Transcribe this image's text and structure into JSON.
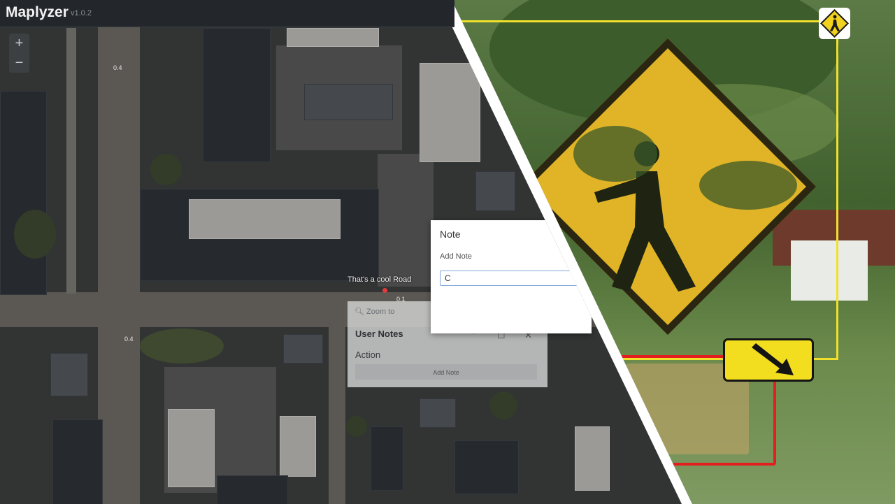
{
  "app": {
    "name": "Maplyzer",
    "version": "v1.0.2"
  },
  "zoom": {
    "in_label": "+",
    "out_label": "−"
  },
  "map": {
    "road_label": "That's a cool Road",
    "scale_labels": [
      "0.4",
      "0.1",
      "0.4"
    ]
  },
  "user_notes": {
    "zoom_to_label": "Zoom to",
    "title": "User Notes",
    "action_label": "Action",
    "add_note_button": "Add Note",
    "window_controls": "⌃ ☐ ✕"
  },
  "note_dialog": {
    "title": "Note",
    "subtitle": "Add Note",
    "input_value": "C"
  },
  "detections": [
    {
      "label": "pedestrian crossing sign",
      "box_color": "#f0e02c"
    },
    {
      "label": "sign",
      "box_color": "#e31e1e"
    }
  ]
}
